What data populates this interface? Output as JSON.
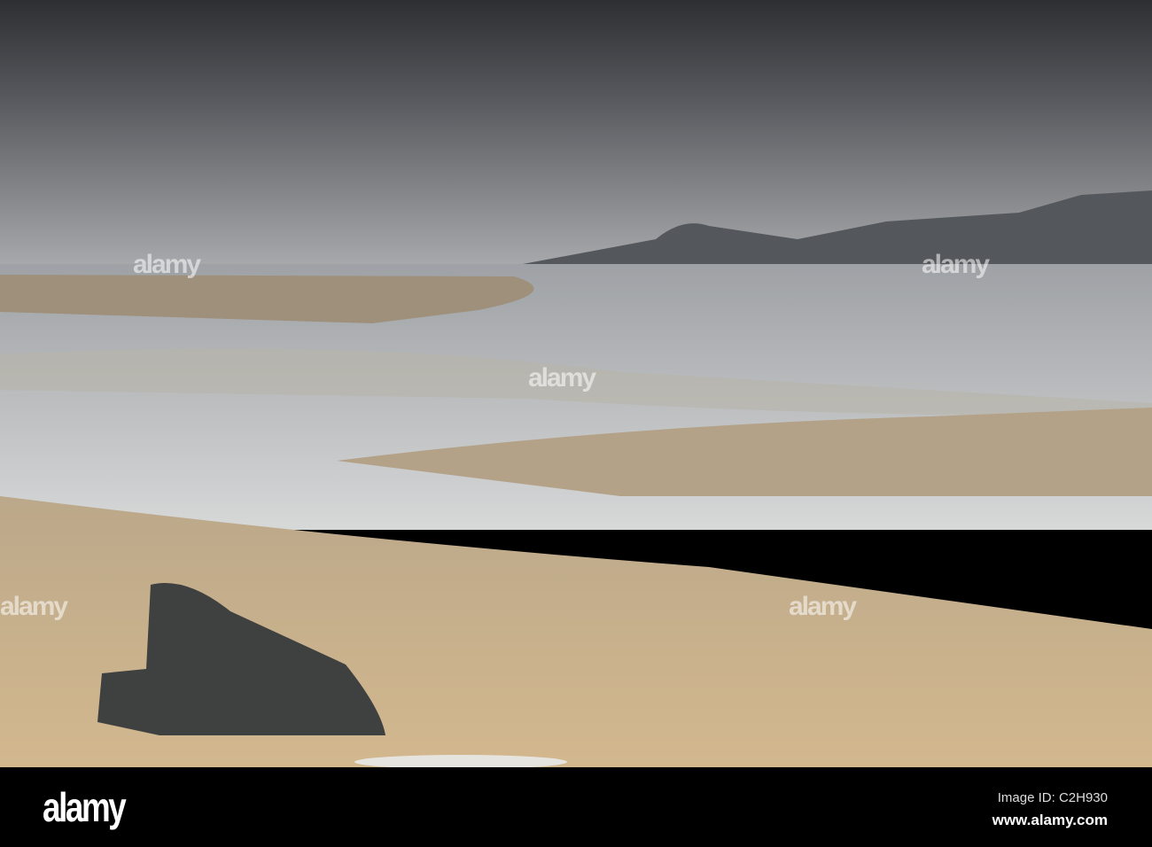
{
  "watermark": {
    "text": "alamy"
  },
  "footer": {
    "logo": "alamy",
    "image_id": "Image ID: C2H930",
    "url": "www.alamy.com"
  }
}
